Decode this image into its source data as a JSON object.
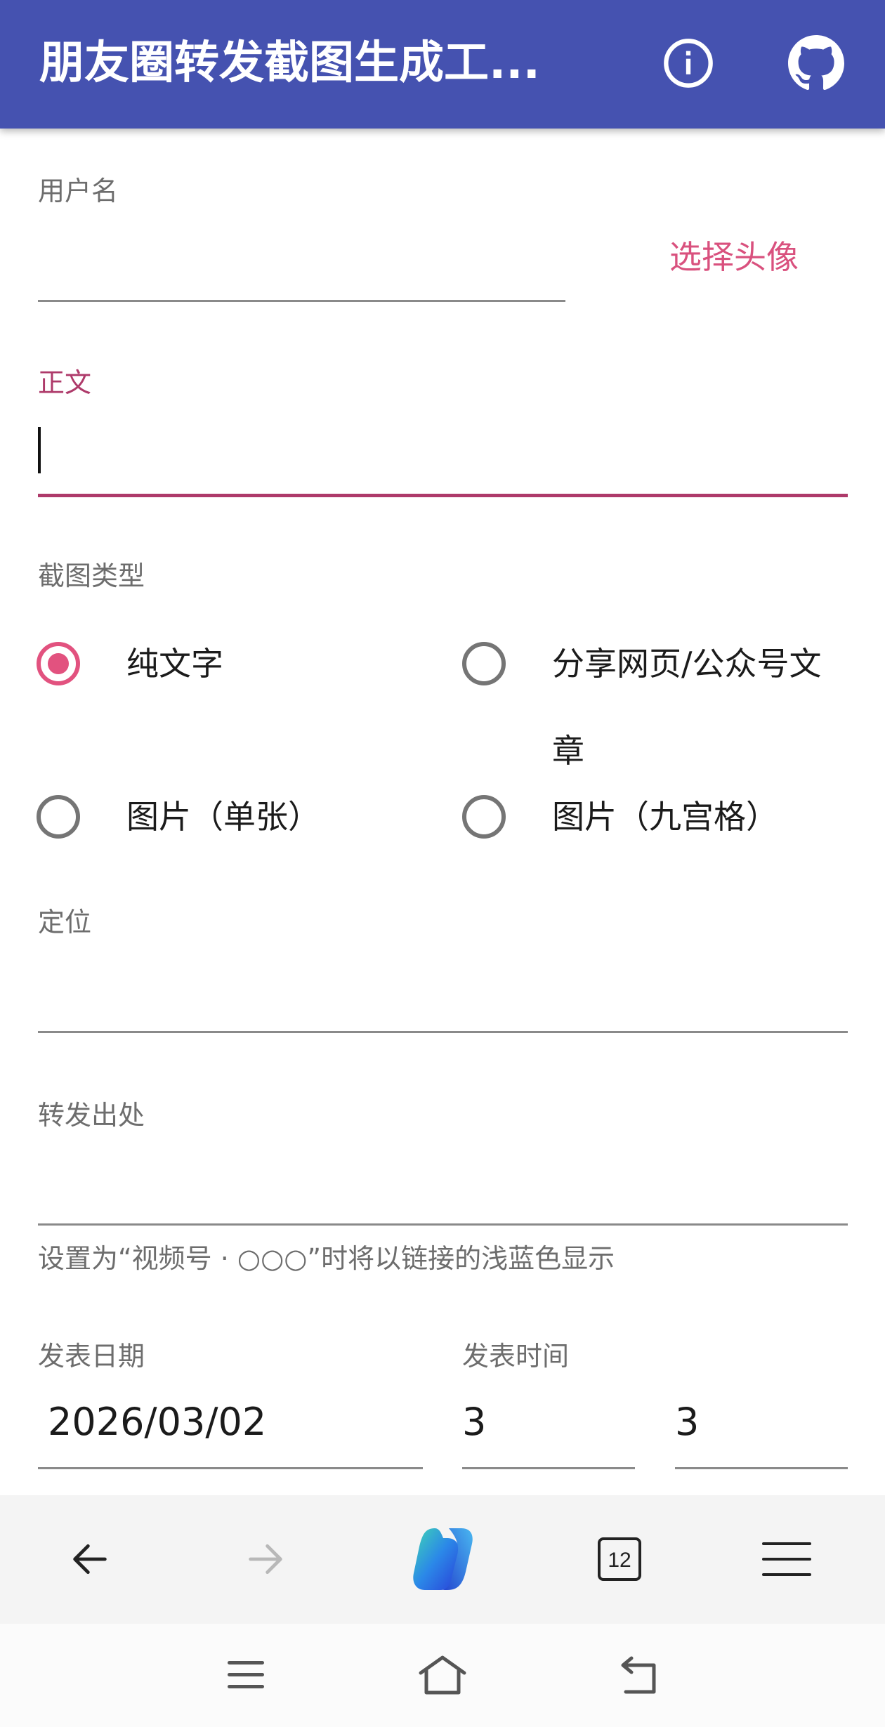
{
  "app": {
    "title": "朋友圈转发截图生成工...",
    "accent": "#4552b0",
    "pink": "#d9517e",
    "focus_color": "#ae3a6a"
  },
  "username": {
    "label": "用户名",
    "value": ""
  },
  "avatar_button": {
    "label": "选择头像"
  },
  "body_text": {
    "label": "正文",
    "value": ""
  },
  "screenshot_type": {
    "label": "截图类型",
    "options": [
      {
        "label": "纯文字",
        "selected": true
      },
      {
        "label": "分享网页/公众号文章",
        "selected": false
      },
      {
        "label": "图片（单张）",
        "selected": false
      },
      {
        "label": "图片（九宫格）",
        "selected": false
      }
    ]
  },
  "location": {
    "label": "定位",
    "value": ""
  },
  "forward_source": {
    "label": "转发出处",
    "value": "",
    "helper": "设置为“视频号 · ○○○”时将以链接的浅蓝色显示"
  },
  "publish": {
    "date_label": "发表日期",
    "date_value": "2026/03/02",
    "time_label": "发表时间",
    "hour_value": "3",
    "minute_value": "3"
  },
  "browser": {
    "tab_count": "12"
  },
  "icons": [
    "info-icon",
    "github-icon",
    "back-arrow-icon",
    "forward-arrow-icon",
    "copilot-icon",
    "tabs-icon",
    "menu-icon",
    "recents-icon",
    "home-icon",
    "system-back-icon"
  ]
}
